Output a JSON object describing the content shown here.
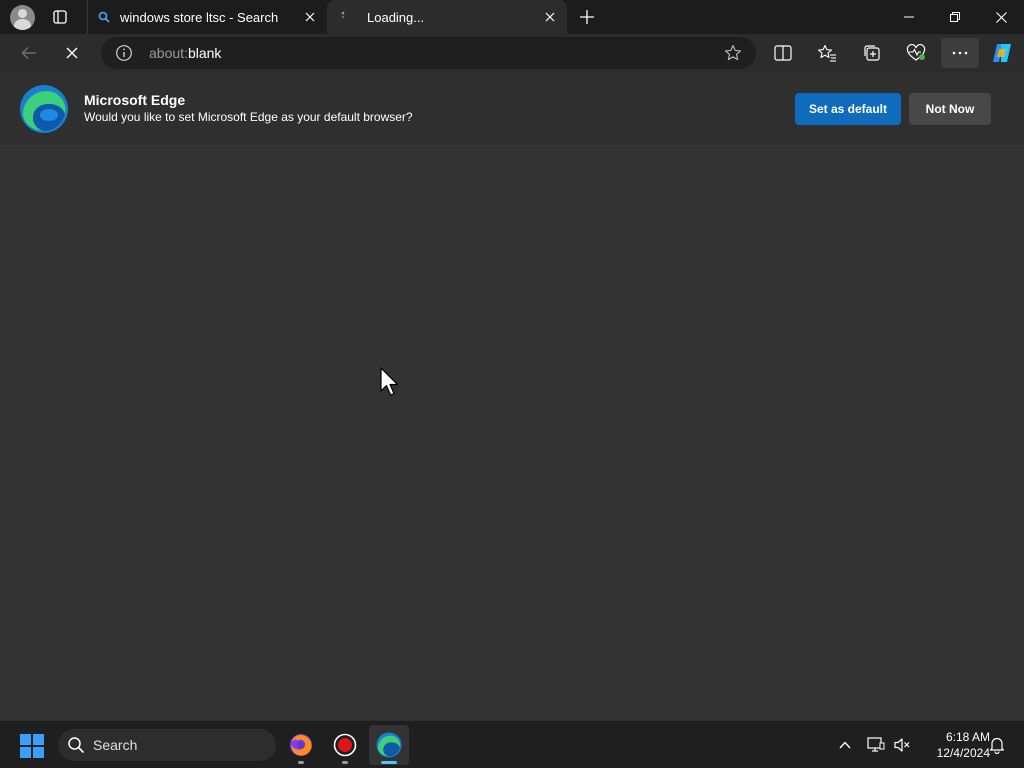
{
  "browser": {
    "tabs": [
      {
        "title": "windows store ltsc - Search",
        "favicon": "search-favicon-icon"
      },
      {
        "title": "Loading...",
        "favicon": "loading-icon"
      }
    ],
    "address": {
      "scheme": "about:",
      "path": "blank"
    }
  },
  "infobar": {
    "title": "Microsoft Edge",
    "message": "Would you like to set Microsoft Edge as your default browser?",
    "primary_label": "Set as default",
    "secondary_label": "Not Now"
  },
  "taskbar": {
    "search_label": "Search",
    "time": "6:18 AM",
    "date": "12/4/2024"
  },
  "colors": {
    "accent": "#0f6cbd",
    "page_bg": "#333333",
    "titlebar_bg": "#1c1c1c"
  }
}
